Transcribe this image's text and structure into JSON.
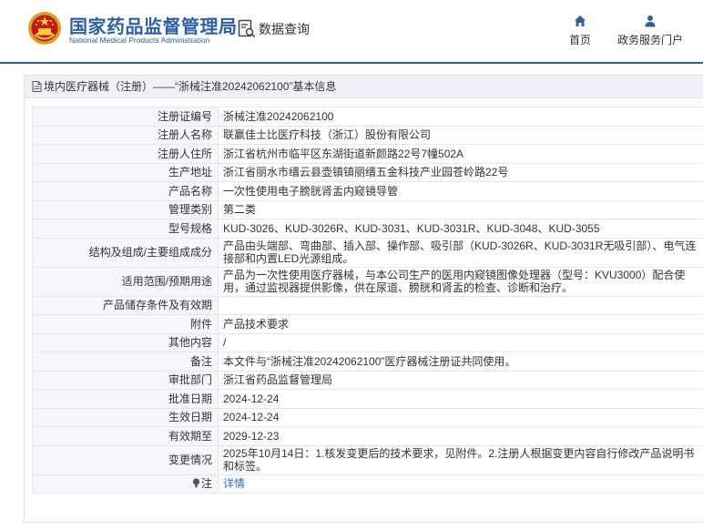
{
  "header": {
    "site_name_cn": "国家药品监督管理局",
    "site_name_en": "National Medical Products Administration",
    "data_query": "数据查询",
    "nav": [
      {
        "label": "首页",
        "icon": "home-icon"
      },
      {
        "label": "政务服务门户",
        "icon": "user-icon"
      }
    ],
    "accent_color": "#2b5fa8"
  },
  "breadcrumb": "境内医疗器械（注册）——“浙械注准20242062100”基本信息",
  "rows": [
    {
      "label": "注册证编号",
      "value": "浙械注准20242062100"
    },
    {
      "label": "注册人名称",
      "value": "联赢佳士比医疗科技（浙江）股份有限公司"
    },
    {
      "label": "注册人住所",
      "value": "浙江省杭州市临平区东湖街道新颜路22号7幢502A"
    },
    {
      "label": "生产地址",
      "value": "浙江省丽水市缙云县壶镇镇丽缙五金科技产业园苍岭路22号"
    },
    {
      "label": "产品名称",
      "value": "一次性使用电子膀胱肾盂内窥镜导管"
    },
    {
      "label": "管理类别",
      "value": "第二类"
    },
    {
      "label": "型号规格",
      "value": "KUD-3026、KUD-3026R、KUD-3031、KUD-3031R、KUD-3048、KUD-3055"
    },
    {
      "label": "结构及组成/主要组成成分",
      "value": "产品由头端部、弯曲部、插入部、操作部、吸引部（KUD-3026R、KUD-3031R无吸引部）、电气连接部和内置LED光源组成。"
    },
    {
      "label": "适用范围/预期用途",
      "value": "产品为一次性使用医疗器械，与本公司生产的医用内窥镜图像处理器（型号：KVU3000）配合使用，通过监视器提供影像，供在尿道、膀胱和肾盂的检查、诊断和治疗。"
    },
    {
      "label": "产品储存条件及有效期",
      "value": ""
    },
    {
      "label": "附件",
      "value": "产品技术要求"
    },
    {
      "label": "其他内容",
      "value": "/"
    },
    {
      "label": "备注",
      "value": "本文件与“浙械注准20242062100”医疗器械注册证共同使用。"
    },
    {
      "label": "审批部门",
      "value": "浙江省药品监督管理局"
    },
    {
      "label": "批准日期",
      "value": "2024-12-24"
    },
    {
      "label": "生效日期",
      "value": "2024-12-24"
    },
    {
      "label": "有效期至",
      "value": "2029-12-23"
    },
    {
      "label": "变更情况",
      "value": "2025年10月14日：1.核发变更后的技术要求，见附件。2.注册人根据变更内容自行修改产品说明书和标签。"
    }
  ],
  "note_row": {
    "label": "注",
    "icon": "lightbulb-icon",
    "link": "详情"
  }
}
